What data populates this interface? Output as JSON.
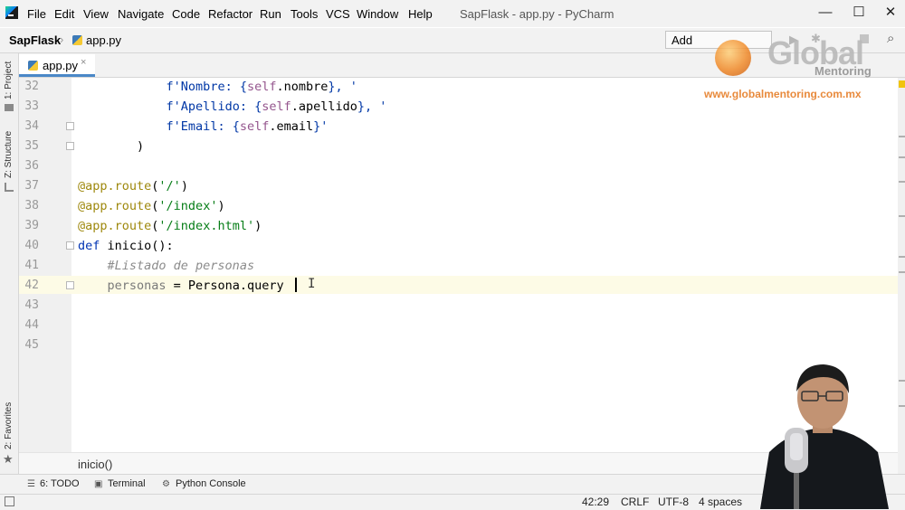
{
  "window": {
    "title": "SapFlask - app.py - PyCharm",
    "menu": [
      "File",
      "Edit",
      "View",
      "Navigate",
      "Code",
      "Refactor",
      "Run",
      "Tools",
      "VCS",
      "Window",
      "Help"
    ],
    "controls": {
      "minimize": "—",
      "maximize": "☐",
      "close": "✕"
    }
  },
  "navbar": {
    "project": "SapFlask",
    "file": "app.py",
    "add_configuration": "Add Configuration..."
  },
  "left_tabs": {
    "project": "1: Project",
    "structure": "Z: Structure",
    "favorites": "2: Favorites"
  },
  "editor_tab": {
    "label": "app.py",
    "close": "×"
  },
  "editor": {
    "line_numbers": [
      "32",
      "33",
      "34",
      "35",
      "36",
      "37",
      "38",
      "39",
      "40",
      "41",
      "42",
      "43",
      "44",
      "45"
    ],
    "current_line": "42"
  },
  "breadcrumb": "inicio()",
  "tool_windows": {
    "todo": "6: TODO",
    "terminal": "Terminal",
    "python_console": "Python Console"
  },
  "status": {
    "position": "42:29",
    "line_separator": "CRLF",
    "encoding": "UTF-8",
    "indent": "4 spaces"
  },
  "watermark": {
    "brand": "Global",
    "sub": "Mentoring",
    "url": "www.globalmentoring.com.mx"
  },
  "colors": {
    "keyword": "#0033b3",
    "string": "#067d17",
    "self": "#94558d",
    "comment": "#8c8c8c",
    "decorator": "#9e880d",
    "current_line": "#fdfbe6"
  }
}
